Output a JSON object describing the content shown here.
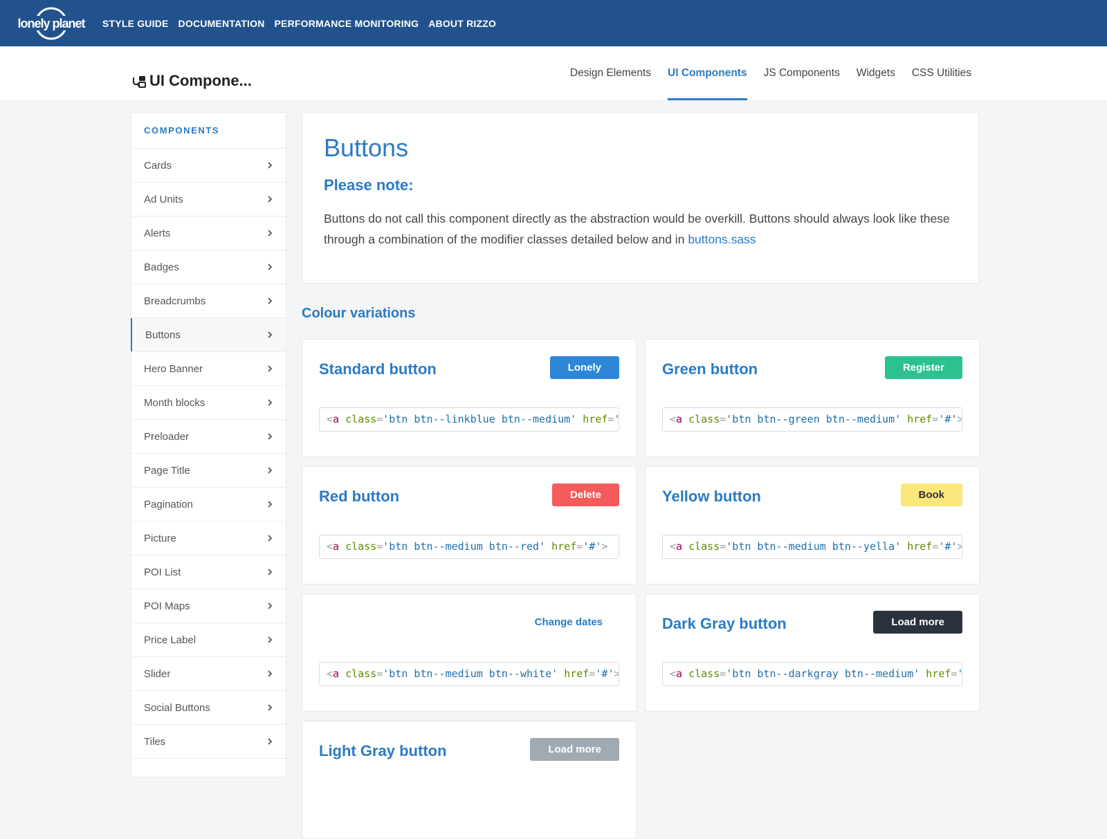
{
  "colors": {
    "topbar": "#22528c",
    "accent": "#2a7bc5",
    "linkblue": "#2d86d6",
    "green": "#2cc28d",
    "red": "#f45b5b",
    "yellow": "#fbe77a",
    "white_button_text": "#2a7bc5",
    "darkgray": "#2a323d",
    "lightgray": "#a0aab2"
  },
  "brand": {
    "logo_text": "lonely planet"
  },
  "topnav": {
    "items": [
      "STYLE GUIDE",
      "DOCUMENTATION",
      "PERFORMANCE MONITORING",
      "ABOUT RIZZO"
    ]
  },
  "header": {
    "title": "UI Compone...",
    "title_icon": "component-icon",
    "tabs": [
      {
        "label": "Design Elements",
        "active": false
      },
      {
        "label": "UI Components",
        "active": true
      },
      {
        "label": "JS Components",
        "active": false
      },
      {
        "label": "Widgets",
        "active": false
      },
      {
        "label": "CSS Utilities",
        "active": false
      }
    ]
  },
  "sidebar": {
    "heading": "COMPONENTS",
    "items": [
      {
        "label": "Cards",
        "active": false
      },
      {
        "label": "Ad Units",
        "active": false
      },
      {
        "label": "Alerts",
        "active": false
      },
      {
        "label": "Badges",
        "active": false
      },
      {
        "label": "Breadcrumbs",
        "active": false
      },
      {
        "label": "Buttons",
        "active": true
      },
      {
        "label": "Hero Banner",
        "active": false
      },
      {
        "label": "Month blocks",
        "active": false
      },
      {
        "label": "Preloader",
        "active": false
      },
      {
        "label": "Page Title",
        "active": false
      },
      {
        "label": "Pagination",
        "active": false
      },
      {
        "label": "Picture",
        "active": false
      },
      {
        "label": "POI List",
        "active": false
      },
      {
        "label": "POI Maps",
        "active": false
      },
      {
        "label": "Price Label",
        "active": false
      },
      {
        "label": "Slider",
        "active": false
      },
      {
        "label": "Social Buttons",
        "active": false
      },
      {
        "label": "Tiles",
        "active": false
      }
    ]
  },
  "intro": {
    "title": "Buttons",
    "subtitle": "Please note:",
    "text": "Buttons do not call this component directly as the abstraction would be overkill. Buttons should always look like these through a combination of the modifier classes detailed below and in",
    "link": "buttons.sass"
  },
  "section": {
    "heading": "Colour variations"
  },
  "examples": {
    "standard": {
      "name": "Standard button",
      "button": "Lonely",
      "code": {
        "open": "<",
        "tag": "a",
        "attr": "class",
        "eq": "=",
        "value": "'btn btn--linkblue btn--medium'",
        "attr2": "href",
        "eq2": "=",
        "value2": "'#'",
        "close": ">"
      }
    },
    "green": {
      "name": "Green button",
      "button": "Register",
      "code": {
        "open": "<",
        "tag": "a",
        "attr": "class",
        "eq": "=",
        "value": "'btn btn--green btn--medium'",
        "attr2": "href",
        "eq2": "=",
        "value2": "'#'",
        "close": ">"
      }
    },
    "red": {
      "name": "Red button",
      "button": "Delete",
      "code": {
        "open": "<",
        "tag": "a",
        "attr": "class",
        "eq": "=",
        "value": "'btn btn--medium btn--red'",
        "attr2": "href",
        "eq2": "=",
        "value2": "'#'",
        "close": ">"
      }
    },
    "yellow": {
      "name": "Yellow button",
      "button": "Book",
      "code": {
        "open": "<",
        "tag": "a",
        "attr": "class",
        "eq": "=",
        "value": "'btn btn--medium btn--yella'",
        "attr2": "href",
        "eq2": "=",
        "value2": "'#'",
        "close": ">"
      }
    },
    "white": {
      "name": "",
      "button": "Change dates",
      "code": {
        "open": "<",
        "tag": "a",
        "attr": "class",
        "eq": "=",
        "value": "'btn btn--medium btn--white'",
        "attr2": "href",
        "eq2": "=",
        "value2": "'#'",
        "close": ">"
      }
    },
    "darkgray": {
      "name": "Dark Gray button",
      "button": "Load more",
      "code": {
        "open": "<",
        "tag": "a",
        "attr": "class",
        "eq": "=",
        "value": "'btn btn--darkgray btn--medium'",
        "attr2": "href",
        "eq2": "=",
        "value2": "'#'",
        "close": ">"
      }
    },
    "lightgray": {
      "name": "Light Gray button",
      "button": "Load more"
    }
  }
}
